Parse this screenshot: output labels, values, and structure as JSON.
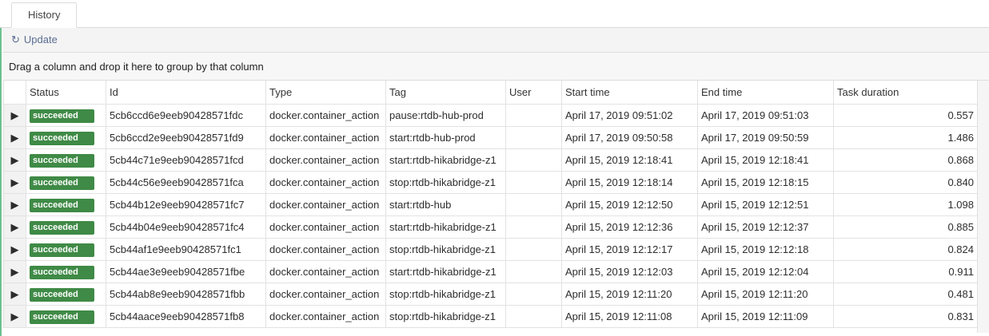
{
  "tab": {
    "label": "History"
  },
  "toolbar": {
    "update_label": "Update",
    "update_icon": "refresh-icon"
  },
  "grouping": {
    "hint": "Drag a column and drop it here to group by that column"
  },
  "columns": [
    "Status",
    "Id",
    "Type",
    "Tag",
    "User",
    "Start time",
    "End time",
    "Task duration"
  ],
  "colors": {
    "success": "#3f8a46",
    "link": "#5a6f95",
    "accent_strip": "#6dbf8d"
  },
  "rows": [
    {
      "status": "succeeded",
      "id": "5cb6ccd6e9eeb90428571fdc",
      "type": "docker.container_action",
      "tag": "pause:rtdb-hub-prod",
      "user": "",
      "start": "April 17, 2019 09:51:02",
      "end": "April 17, 2019 09:51:03",
      "duration": "0.557"
    },
    {
      "status": "succeeded",
      "id": "5cb6ccd2e9eeb90428571fd9",
      "type": "docker.container_action",
      "tag": "start:rtdb-hub-prod",
      "user": "",
      "start": "April 17, 2019 09:50:58",
      "end": "April 17, 2019 09:50:59",
      "duration": "1.486"
    },
    {
      "status": "succeeded",
      "id": "5cb44c71e9eeb90428571fcd",
      "type": "docker.container_action",
      "tag": "start:rtdb-hikabridge-z1",
      "user": "",
      "start": "April 15, 2019 12:18:41",
      "end": "April 15, 2019 12:18:41",
      "duration": "0.868"
    },
    {
      "status": "succeeded",
      "id": "5cb44c56e9eeb90428571fca",
      "type": "docker.container_action",
      "tag": "stop:rtdb-hikabridge-z1",
      "user": "",
      "start": "April 15, 2019 12:18:14",
      "end": "April 15, 2019 12:18:15",
      "duration": "0.840"
    },
    {
      "status": "succeeded",
      "id": "5cb44b12e9eeb90428571fc7",
      "type": "docker.container_action",
      "tag": "start:rtdb-hub",
      "user": "",
      "start": "April 15, 2019 12:12:50",
      "end": "April 15, 2019 12:12:51",
      "duration": "1.098"
    },
    {
      "status": "succeeded",
      "id": "5cb44b04e9eeb90428571fc4",
      "type": "docker.container_action",
      "tag": "start:rtdb-hikabridge-z1",
      "user": "",
      "start": "April 15, 2019 12:12:36",
      "end": "April 15, 2019 12:12:37",
      "duration": "0.885"
    },
    {
      "status": "succeeded",
      "id": "5cb44af1e9eeb90428571fc1",
      "type": "docker.container_action",
      "tag": "stop:rtdb-hikabridge-z1",
      "user": "",
      "start": "April 15, 2019 12:12:17",
      "end": "April 15, 2019 12:12:18",
      "duration": "0.824"
    },
    {
      "status": "succeeded",
      "id": "5cb44ae3e9eeb90428571fbe",
      "type": "docker.container_action",
      "tag": "start:rtdb-hikabridge-z1",
      "user": "",
      "start": "April 15, 2019 12:12:03",
      "end": "April 15, 2019 12:12:04",
      "duration": "0.911"
    },
    {
      "status": "succeeded",
      "id": "5cb44ab8e9eeb90428571fbb",
      "type": "docker.container_action",
      "tag": "stop:rtdb-hikabridge-z1",
      "user": "",
      "start": "April 15, 2019 12:11:20",
      "end": "April 15, 2019 12:11:20",
      "duration": "0.481"
    },
    {
      "status": "succeeded",
      "id": "5cb44aace9eeb90428571fb8",
      "type": "docker.container_action",
      "tag": "stop:rtdb-hikabridge-z1",
      "user": "",
      "start": "April 15, 2019 12:11:08",
      "end": "April 15, 2019 12:11:09",
      "duration": "0.831"
    }
  ]
}
